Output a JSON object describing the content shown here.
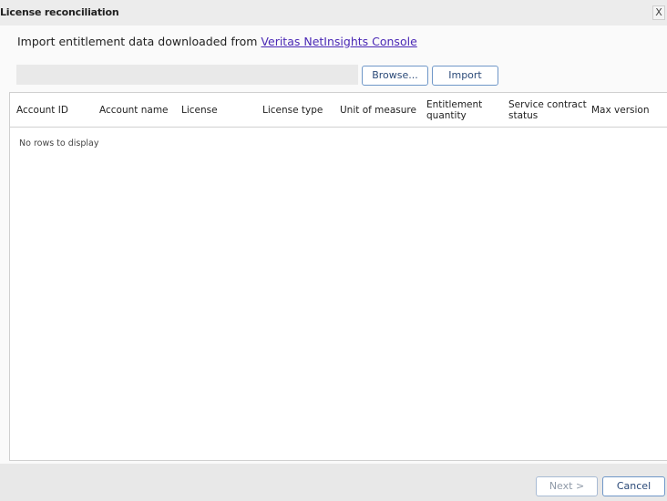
{
  "dialog": {
    "title": "License reconciliation",
    "close_label": "X"
  },
  "intro": {
    "text": "Import entitlement data downloaded from ",
    "link_text": "Veritas NetInsights Console"
  },
  "file_input": {
    "value": ""
  },
  "buttons": {
    "browse": "Browse...",
    "import": "Import",
    "next": "Next >",
    "cancel": "Cancel"
  },
  "grid": {
    "columns": [
      "Account ID",
      "Account name",
      "License",
      "License type",
      "Unit of measure",
      "Entitlement\nquantity",
      "Service contract\nstatus",
      "Max version"
    ],
    "rows": [],
    "empty_text": "No rows to display"
  }
}
